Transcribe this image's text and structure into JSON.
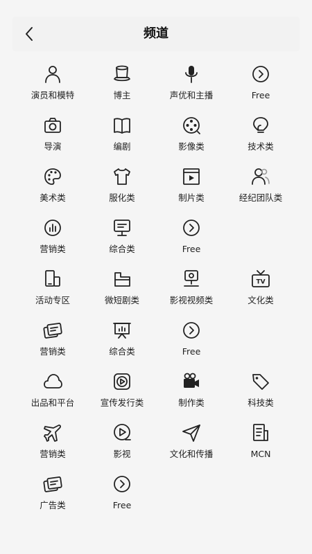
{
  "header": {
    "title": "频道"
  },
  "channels": [
    {
      "label": "演员和模特",
      "icon": "person-icon"
    },
    {
      "label": "博主",
      "icon": "top-hat-icon"
    },
    {
      "label": "声优和主播",
      "icon": "microphone-icon"
    },
    {
      "label": "Free",
      "icon": "chevron-circle-icon"
    },
    {
      "label": "导演",
      "icon": "camera-icon"
    },
    {
      "label": "编剧",
      "icon": "book-icon"
    },
    {
      "label": "影像类",
      "icon": "film-reel-icon"
    },
    {
      "label": "技术类",
      "icon": "lightbulb-icon"
    },
    {
      "label": "美术类",
      "icon": "palette-icon"
    },
    {
      "label": "服化类",
      "icon": "tshirt-icon"
    },
    {
      "label": "制片类",
      "icon": "video-frame-icon"
    },
    {
      "label": "经纪团队类",
      "icon": "team-icon"
    },
    {
      "label": "营销类",
      "icon": "chart-circle-icon"
    },
    {
      "label": "综合类",
      "icon": "monitor-icon"
    },
    {
      "label": "Free",
      "icon": "chevron-circle-icon"
    },
    {
      "label": "",
      "icon": ""
    },
    {
      "label": "活动专区",
      "icon": "devices-icon"
    },
    {
      "label": "微短剧类",
      "icon": "folder-icon"
    },
    {
      "label": "影视视频类",
      "icon": "webcam-icon"
    },
    {
      "label": "文化类",
      "icon": "tv-icon"
    },
    {
      "label": "营销类",
      "icon": "cards-icon"
    },
    {
      "label": "综合类",
      "icon": "presentation-icon"
    },
    {
      "label": "Free",
      "icon": "chevron-circle-icon"
    },
    {
      "label": "",
      "icon": ""
    },
    {
      "label": "出品和平台",
      "icon": "cloud-icon"
    },
    {
      "label": "宣传发行类",
      "icon": "play-square-icon"
    },
    {
      "label": "制作类",
      "icon": "video-camera-icon"
    },
    {
      "label": "科技类",
      "icon": "tag-icon"
    },
    {
      "label": "营销类",
      "icon": "plane-icon"
    },
    {
      "label": "影视",
      "icon": "play-circle-icon"
    },
    {
      "label": "文化和传播",
      "icon": "paper-plane-icon"
    },
    {
      "label": "MCN",
      "icon": "document-icon"
    },
    {
      "label": "广告类",
      "icon": "cards-icon"
    },
    {
      "label": "Free",
      "icon": "chevron-circle-icon"
    }
  ]
}
